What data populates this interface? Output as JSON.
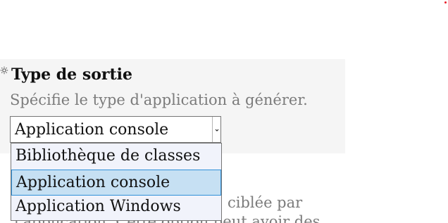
{
  "setting": {
    "title": "Type de sortie",
    "description": "Spécifie le type d'application à générer.",
    "selected_value": "Application console"
  },
  "dropdown": {
    "options": [
      {
        "label": "Bibliothèque de classes",
        "selected": false
      },
      {
        "label": "Application console",
        "selected": true
      },
      {
        "label": "Application Windows",
        "selected": false
      }
    ]
  },
  "underlying_text": {
    "line1": "ciblée par",
    "line2": "l'application. Cette option peut avoir des"
  },
  "icons": {
    "setting_icon": "gear-icon",
    "select_arrow": "chevron-down-icon"
  },
  "colors": {
    "panel_background": "#f5f5f5",
    "selected_option_background": "#c6e0f3",
    "selected_option_border": "#2f8fd8",
    "dropdown_background": "#f1f3fb",
    "description_text": "#7b7b7b"
  }
}
